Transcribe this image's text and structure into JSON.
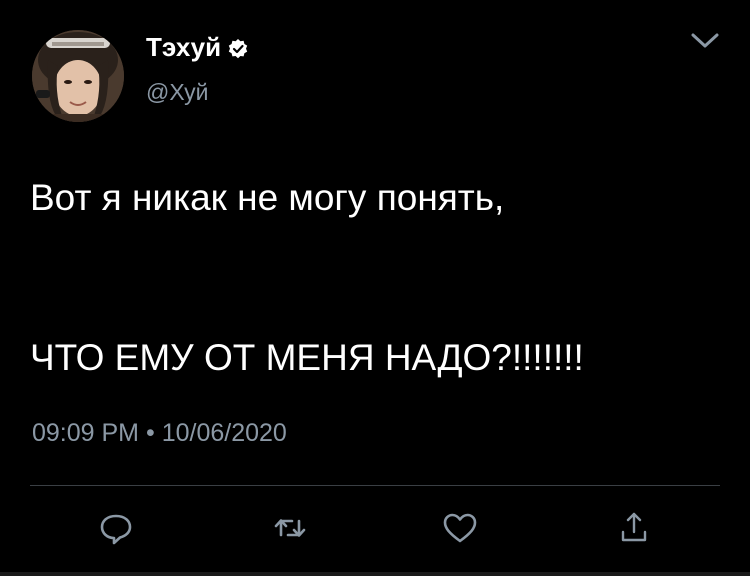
{
  "tweet": {
    "author": {
      "display_name": "Тэхуй",
      "handle": "@Хуй",
      "verified": true,
      "avatar_icon": "profile-photo"
    },
    "text_line1": "Вот я никак не могу понять,",
    "text_line2": "ЧТО ЕМУ ОТ МЕНЯ НАДО?!!!!!!!",
    "time": "09:09 PM",
    "separator": "•",
    "date": "10/06/2020"
  },
  "actions": {
    "reply_icon": "reply-icon",
    "retweet_icon": "retweet-icon",
    "like_icon": "heart-icon",
    "share_icon": "share-icon",
    "menu_icon": "chevron-down-icon"
  },
  "colors": {
    "background": "#000000",
    "text": "#ffffff",
    "secondary": "#8b98a5",
    "icon": "#8b98a5",
    "divider": "#3a3f44"
  }
}
